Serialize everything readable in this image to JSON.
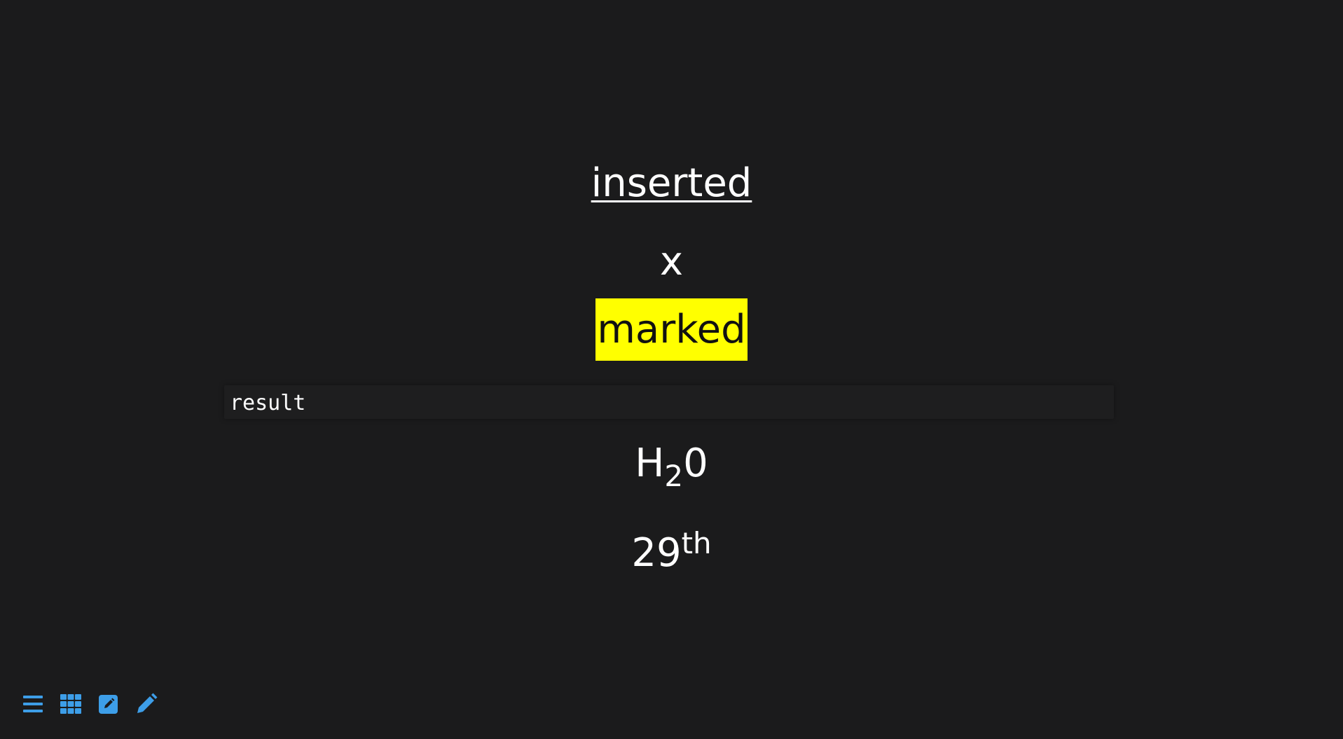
{
  "slide": {
    "inserted_text": "inserted",
    "variable_text": "x",
    "marked_text": "marked",
    "code_text": "result",
    "formula": {
      "base1": "H",
      "sub": "2",
      "base2": "0"
    },
    "ordinal": {
      "number": "29",
      "sup": "th"
    }
  },
  "controls": {
    "accent_color": "#3d9ee8",
    "icons": [
      "menu-icon",
      "grid-icon",
      "edit-square-icon",
      "pencil-icon"
    ]
  },
  "colors": {
    "background": "#1b1b1c",
    "text": "#ffffff",
    "highlight": "#ffff00"
  }
}
